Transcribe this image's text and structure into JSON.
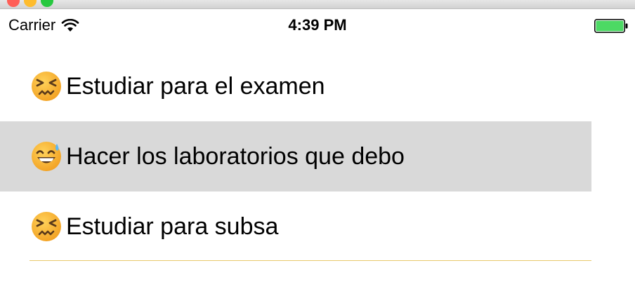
{
  "status_bar": {
    "carrier": "Carrier",
    "time": "4:39 PM",
    "battery_color": "#4cd964"
  },
  "tasks": [
    {
      "emoji": "confounded-face-icon",
      "label": "Estudiar para el examen",
      "selected": false
    },
    {
      "emoji": "grinning-sweat-face-icon",
      "label": "Hacer los laboratorios que debo",
      "selected": true
    },
    {
      "emoji": "confounded-face-icon",
      "label": "Estudiar para subsa",
      "selected": false
    }
  ],
  "colors": {
    "selected_row": "#d9d9d9",
    "separator": "#e8c96a"
  }
}
